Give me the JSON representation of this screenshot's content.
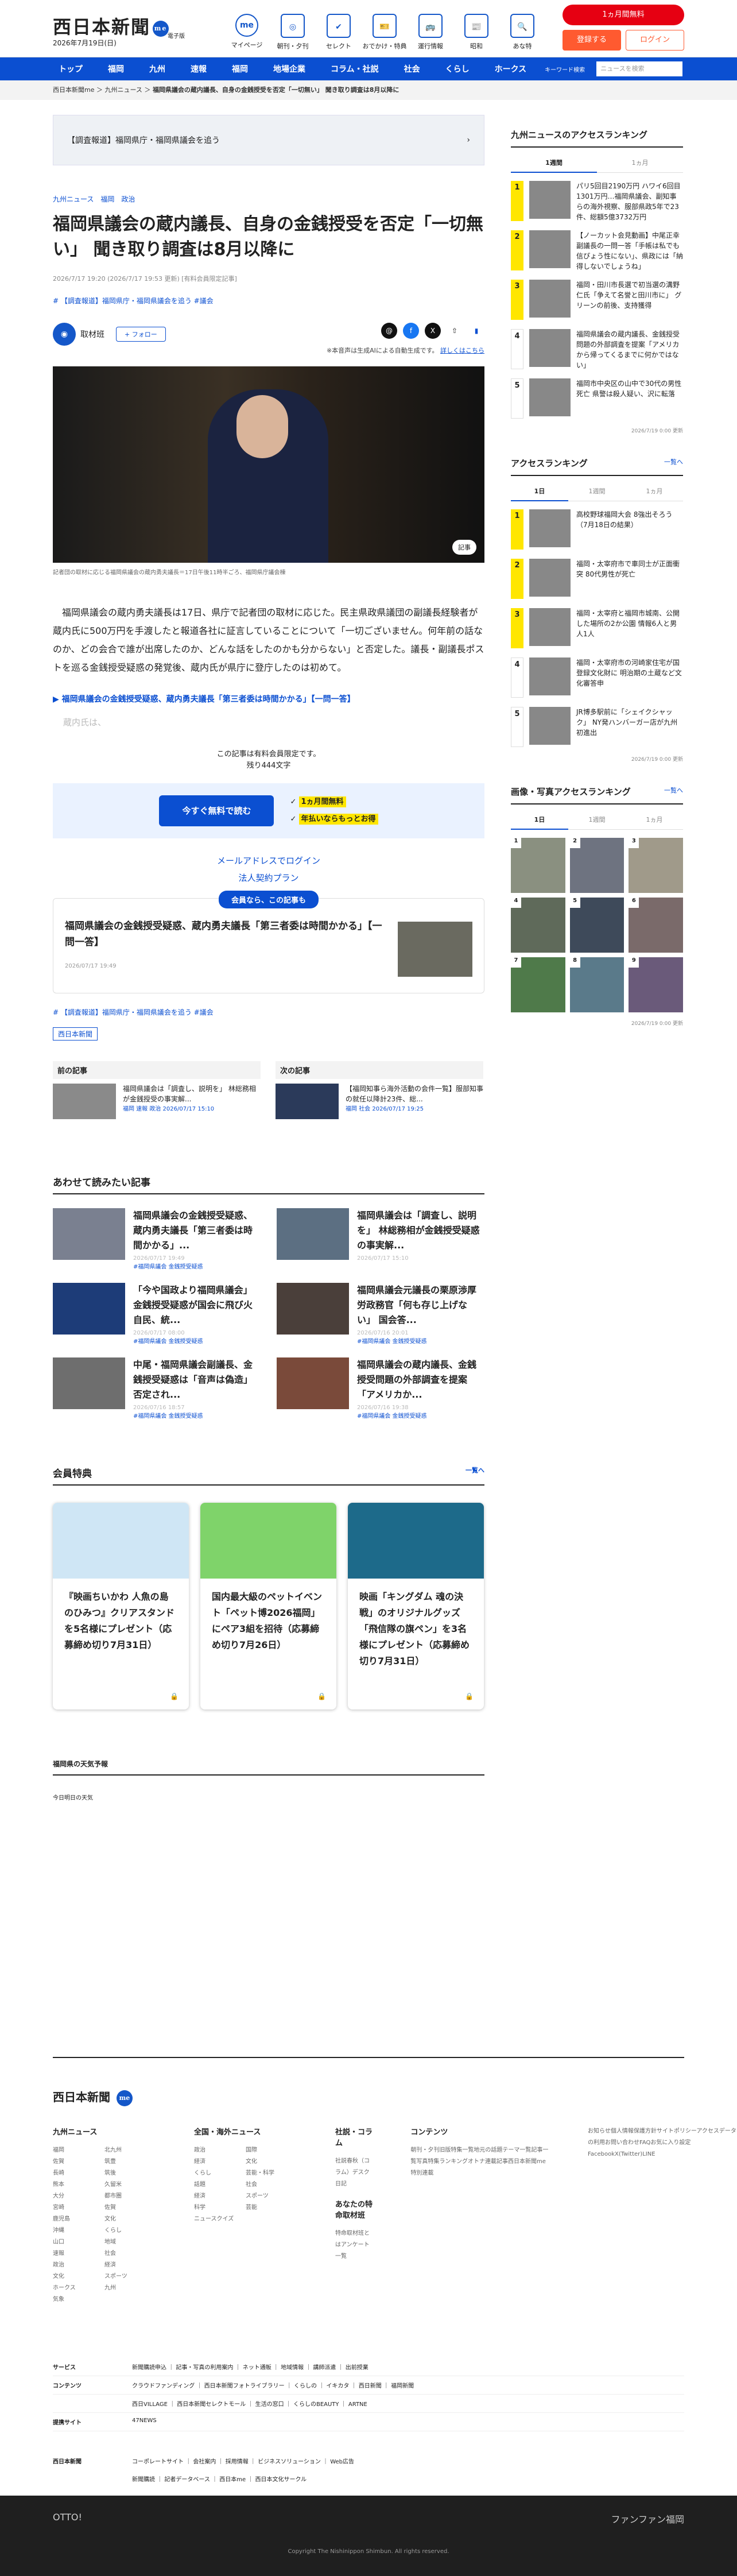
{
  "header": {
    "logo": "西日本新聞",
    "badge": "me",
    "date": "2026年7月19日(日)",
    "sub": "電子版",
    "icons": [
      {
        "label": "マイページ",
        "g": "me"
      },
      {
        "label": "朝刊・夕刊",
        "g": "◎"
      },
      {
        "label": "セレクト",
        "g": "✔"
      },
      {
        "label": "おでかけ・特典",
        "g": "🎫"
      },
      {
        "label": "運行情報",
        "g": "🚌"
      },
      {
        "label": "昭和",
        "g": "📰"
      },
      {
        "label": "あな特",
        "g": "🔍"
      }
    ],
    "trial": "1ヵ月間無料",
    "register": "登録する",
    "login": "ログイン"
  },
  "nav": {
    "items": [
      "トップ",
      "福岡",
      "九州",
      "速報",
      "福岡",
      "地場企業",
      "コラム・社説",
      "社会",
      "くらし",
      "ホークス"
    ],
    "keyword": "キーワード検索",
    "search_placeholder": "ニュースを検索"
  },
  "breadcrumb": [
    "西日本新聞me",
    "九州ニュース",
    "福岡県議会の蔵内議長、自身の金銭授受を否定「一切無い」 聞き取り調査は8月以降に"
  ],
  "article": {
    "banner": "【調査報道】福岡県庁・福岡県議会を追う",
    "tags": [
      "九州ニュース",
      "福岡",
      "政治"
    ],
    "title": "福岡県議会の蔵内議長、自身の金銭授受を否定「一切無い」 聞き取り調査は8月以降に",
    "dates": "2026/7/17 19:20 (2026/7/17 19:53 更新) [有料会員限定記事]",
    "keywords": "# 【調査報道】福岡県庁・福岡県議会を追う  #議会",
    "author": "取材班",
    "follow": "+ フォロー",
    "audio_note": "※本音声は生成AIによる自動生成です。",
    "audio_link": "詳しくはこちら",
    "caption_btn": "記事",
    "caption": "記者団の取材に応じる福岡県議会の蔵内勇夫議長＝17日午後11時半ごろ、福岡県庁議会棟",
    "body": "福岡県議会の蔵内勇夫議長は17日、県庁で記者団の取材に応じた。民主県政県議団の副議長経験者が蔵内氏に500万円を手渡したと報道各社に証言していることについて「一切ございません。何年前の話なのか、どの会合で誰が出席したのか、どんな話をしたのかも分からない」と否定した。議長・副議長ポストを巡る金銭授受疑惑の発覚後、蔵内氏が県庁に登庁したのは初めて。",
    "related": "▶ 福岡県議会の金銭授受疑惑、蔵内勇夫議長「第三者委は時間かかる」【一問一答】",
    "fade": "蔵内氏は、",
    "paywall": "この記事は有料会員限定です。",
    "remain": "残り444文字",
    "cta": "今すぐ無料で読む",
    "cta_p1": "1ヵ月間無料",
    "cta_p2": "年払いならもっとお得",
    "mail_login": "メールアドレスでログイン",
    "corp": "法人契約プラン",
    "free_badge": "会員なら、この記事も",
    "free_title": "福岡県議会の金銭授受疑惑、蔵内勇夫議長「第三者委は時間かかる」【一問一答】",
    "free_date": "2026/07/17 19:49",
    "keywords2": "# 【調査報道】福岡県庁・福岡県議会を追う  #議会",
    "pub": "西日本新聞"
  },
  "prevnext": [
    {
      "h": "前の記事",
      "t": "福岡県議会は「調査し、説明を」 林総務相が金銭授受の事実解...",
      "k": "福岡 速報 政治 2026/07/17 15:10"
    },
    {
      "h": "次の記事",
      "t": "【福岡知事ら海外活動の会件一覧】服部知事の就任以降計23件、総...",
      "k": "福岡 社会 2026/07/17 19:25"
    }
  ],
  "recommend": {
    "title": "あわせて読みたい記事",
    "items": [
      {
        "t": "福岡県議会の金銭授受疑惑、蔵内勇夫議長「第三者委は時間かかる」...",
        "d": "2026/07/17 19:49",
        "k": "#福岡県議会 金銭授受疑惑"
      },
      {
        "t": "福岡県議会は「調査し、説明を」 林総務相が金銭授受疑惑の事実解...",
        "d": "2026/07/17 15:10",
        "k": ""
      },
      {
        "t": "「今や国政より福岡県議会」金銭授受疑惑が国会に飛び火 自民、統...",
        "d": "2026/07/17 08:00",
        "k": "#福岡県議会 金銭授受疑惑"
      },
      {
        "t": "福岡県議会元議長の栗原渉厚労政務官「何も存じ上げない」 国会答...",
        "d": "2026/07/16 20:01",
        "k": "#福岡県議会 金銭授受疑惑"
      },
      {
        "t": "中尾・福岡県議会副議長、金銭授受疑惑は「音声は偽造」 否定され...",
        "d": "2026/07/16 18:57",
        "k": "#福岡県議会 金銭授受疑惑"
      },
      {
        "t": "福岡県議会の蔵内議長、金銭授受問題の外部調査を提案「アメリカか...",
        "d": "2026/07/16 19:38",
        "k": "#福岡県議会 金銭授受疑惑"
      }
    ]
  },
  "members": {
    "title": "会員特典",
    "more": "一覧へ",
    "cards": [
      {
        "t": "『映画ちいかわ 人魚の島のひみつ』クリアスタンドを5名様にプレゼント（応募締め切り7月31日）",
        "c": "#cfe6f5"
      },
      {
        "t": "国内最大級のペットイベント「ペット博2026福岡」にペア3組を招待（応募締め切り7月26日）",
        "c": "#7fd36a"
      },
      {
        "t": "映画「キングダム 魂の決戦」のオリジナルグッズ「飛信隊の旗ペン」を3名様にプレゼント（応募締め切り7月31日）",
        "c": "#1d6a8a"
      }
    ]
  },
  "weather": {
    "title": "福岡県の天気予報",
    "today": "今日明日の天気"
  },
  "side": {
    "rank1": {
      "title": "九州ニュースのアクセスランキング",
      "tabs": [
        "1週間",
        "1ヵ月"
      ],
      "items": [
        "パリ5回目2190万円 ハワイ6回目1301万円…福岡県議会、副知事らの海外視察、服部県政5年で23件、総額5億3732万円",
        "【ノーカット会見動画】中尾正幸副議長の一問一答「手帳は私でも信ぴょう性にない」、県政には「納得しないでしょうね」",
        "福岡・田川市長選で初当選の溝野仁氏「争えて名誉と田川市に」 グリーンの前後、支持獲得",
        "福岡県議会の蔵内議長、金銭授受問題の外部調査を提案「アメリカから帰ってくるまでに何かではない」",
        "福岡市中央区の山中で30代の男性死亡 県警は殺人疑い、沢に転落"
      ],
      "upd": "2026/7/19 0:00 更新"
    },
    "rank2": {
      "title": "アクセスランキング",
      "more": "一覧へ",
      "tabs": [
        "1日",
        "1週間",
        "1ヵ月"
      ],
      "items": [
        "高校野球福岡大会 8強出そろう（7月18日の結果）",
        "福岡・太宰府市で車同士が正面衝突 80代男性が死亡",
        "福岡・太宰府と福岡市城南、公開した場所の2か公園 情報6人と男人1人",
        "福岡・太宰府市の河崎家住宅が国登録文化財に 明治期の土蔵など文化審答申",
        "JR博多駅前に「シェイクシャック」 NY発ハンバーガー店が九州初進出"
      ],
      "upd": "2026/7/19 0:00 更新"
    },
    "photo": {
      "title": "画像・写真アクセスランキング",
      "more": "一覧へ",
      "tabs": [
        "1日",
        "1週間",
        "1ヵ月"
      ],
      "upd": "2026/7/19 0:00 更新"
    }
  },
  "footer": {
    "logo": "西日本新聞",
    "badge": "me",
    "cols": [
      {
        "h": "九州ニュース",
        "l": [
          "福岡",
          "佐賀",
          "長崎",
          "熊本",
          "大分",
          "宮崎",
          "鹿児島",
          "沖縄",
          "山口",
          "速報",
          "社会",
          "政治",
          "経済",
          "文化",
          "スポーツ",
          "ホークス",
          "九州",
          "気象"
        ],
        "l2": [
          "北九州",
          "筑豊",
          "筑後",
          "久留米",
          "都市圏",
          "佐賀",
          "文化",
          "くらし",
          "地域",
          "医療",
          "科学・環境",
          "話題",
          "ニュース",
          "こどもタイムス",
          "福岡ソフトバンクホークス"
        ]
      },
      {
        "h": "全国・海外ニュース",
        "l": [
          "政治",
          "国際",
          "経済",
          "文化",
          "くらし",
          "芸能・科学",
          "話題",
          "社会",
          "経済",
          "スポーツ",
          "科学",
          "芸能",
          "ニュースクイズ"
        ],
        "l2": []
      },
      {
        "h": "社説・コラム",
        "l": [
          "社説",
          "春秋（コラム）",
          "デスク日記"
        ],
        "l2": []
      },
      {
        "h": "コンテンツ",
        "l": [
          "朝刊・夕刊",
          "旧版",
          "特集一覧",
          "地元の話題",
          "テーマ一覧",
          "記事一覧",
          "写真特集",
          "ランキング",
          "オトナ",
          "連載記事",
          "西日本新聞me 特別連載"
        ],
        "l2": []
      },
      {
        "h": "",
        "l": [
          "お知らせ",
          "個人情報保護方針",
          "サイトポリシー",
          "アクセスデータの利用",
          "お問い合わせ",
          "FAQ",
          "お気に入り設定",
          "Facebook",
          "X(Twitter)",
          "LINE"
        ],
        "l2": []
      }
    ],
    "extra_head": "あなたの特命取材班",
    "extra": [
      "特命取材班とは",
      "アンケート一覧"
    ],
    "services": [
      {
        "h": "サービス",
        "l": "新聞購読申込 ｜ 記事・写真の利用案内 ｜ ネット通販 ｜ 地域情報 ｜ 講師派遣 ｜ 出前授業"
      },
      {
        "h": "コンテンツ",
        "l": "クラウドファンディング ｜ 西日本新聞フォトライブラリー ｜ くらしの ｜ イキカタ ｜ 西日新聞 ｜ 福岡新聞"
      },
      {
        "h": "",
        "l": "西日VILLAGE ｜ 西日本新聞セレクトモール ｜ 生活の窓口 ｜ くらしのBEAUTY ｜ ARTNE"
      },
      {
        "h": "提携サイト",
        "l": "47NEWS"
      }
    ],
    "corp": "コーポレートサイト ｜ 会社案内 ｜ 採用情報 ｜ ビジネスソリューション ｜ Web広告",
    "corp2": "新聞購読 ｜ 記者データベース ｜ 西日本me ｜ 西日本文化サークル",
    "copy": "Copyright The Nishinippon Shimbun. All rights reserved.",
    "brand1": "OTTO!",
    "brand2": "ファンファン福岡"
  }
}
